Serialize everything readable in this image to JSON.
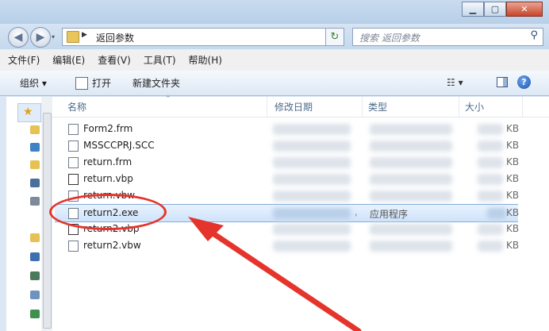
{
  "titlebar": {
    "min_icon": "minimize-icon",
    "max_icon": "maximize-icon",
    "close_icon": "close-icon"
  },
  "address": {
    "crumb": "返回参数",
    "search_placeholder": "搜索 返回参数"
  },
  "menu": [
    "文件(F)",
    "编辑(E)",
    "查看(V)",
    "工具(T)",
    "帮助(H)"
  ],
  "toolbar": {
    "organize": "组织 ▾",
    "open": "打开",
    "new_folder": "新建文件夹"
  },
  "columns": {
    "name": "名称",
    "date": "修改日期",
    "type": "类型",
    "size": "大小"
  },
  "files": [
    {
      "name": "Form2.frm",
      "size_unit": "KB"
    },
    {
      "name": "MSSCCPRJ.SCC",
      "size_unit": "KB"
    },
    {
      "name": "return.frm",
      "size_unit": "KB"
    },
    {
      "name": "return.vbp",
      "size_unit": "KB"
    },
    {
      "name": "return.vbw",
      "size_unit": "KB"
    },
    {
      "name": "return2.exe",
      "type": "应用程序",
      "size_unit": "KB",
      "selected": true
    },
    {
      "name": "return2.vbp",
      "size_unit": "KB"
    },
    {
      "name": "return2.vbw",
      "size_unit": "KB"
    }
  ],
  "colors": {
    "annotation_red": "#e5342b",
    "selection": "#cfe3fb"
  }
}
